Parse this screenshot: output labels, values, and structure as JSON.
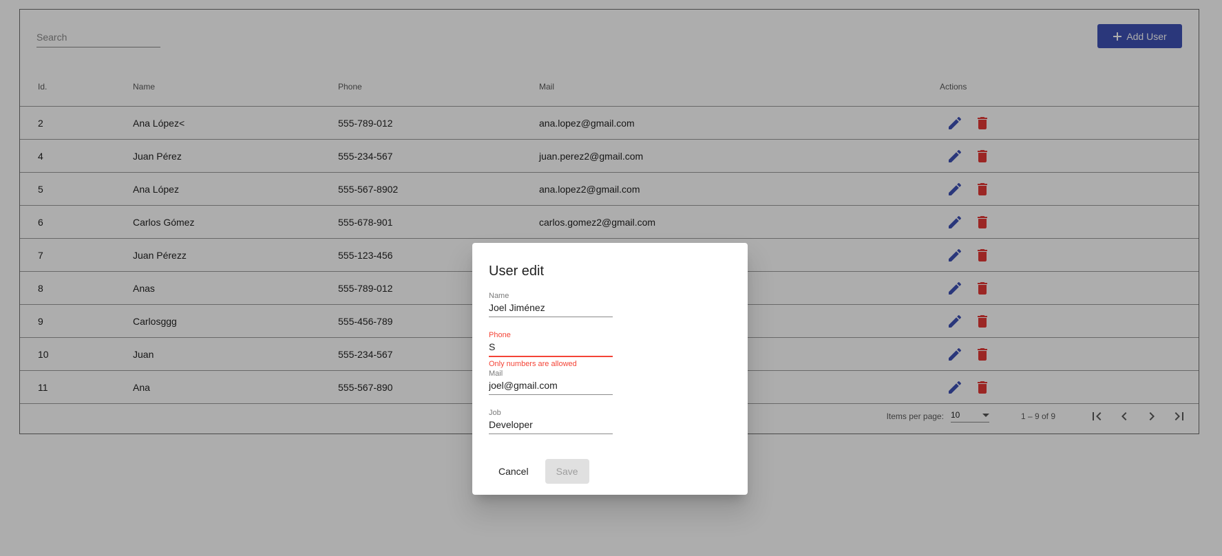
{
  "toolbar": {
    "search_placeholder": "Search",
    "add_user_label": "Add User"
  },
  "table": {
    "headers": {
      "id": "Id.",
      "name": "Name",
      "phone": "Phone",
      "mail": "Mail",
      "actions": "Actions"
    },
    "rows": [
      {
        "id": "2",
        "name": "Ana López<",
        "phone": "555-789-012",
        "mail": "ana.lopez@gmail.com"
      },
      {
        "id": "4",
        "name": "Juan Pérez",
        "phone": "555-234-567",
        "mail": "juan.perez2@gmail.com"
      },
      {
        "id": "5",
        "name": "Ana López",
        "phone": "555-567-8902",
        "mail": "ana.lopez2@gmail.com"
      },
      {
        "id": "6",
        "name": "Carlos Gómez",
        "phone": "555-678-901",
        "mail": "carlos.gomez2@gmail.com"
      },
      {
        "id": "7",
        "name": "Juan Pérezz",
        "phone": "555-123-456",
        "mail": ""
      },
      {
        "id": "8",
        "name": "Anas",
        "phone": "555-789-012",
        "mail": ""
      },
      {
        "id": "9",
        "name": "Carlosggg",
        "phone": "555-456-789",
        "mail": ""
      },
      {
        "id": "10",
        "name": "Juan",
        "phone": "555-234-567",
        "mail": ""
      },
      {
        "id": "11",
        "name": "Ana",
        "phone": "555-567-890",
        "mail": ""
      }
    ]
  },
  "paginator": {
    "items_per_page_label": "Items per page:",
    "items_per_page_value": "10",
    "range_label": "1 – 9 of 9"
  },
  "dialog": {
    "title": "User edit",
    "fields": {
      "name": {
        "label": "Name",
        "value": "Joel Jiménez"
      },
      "phone": {
        "label": "Phone",
        "value": "S",
        "error": "Only numbers are allowed"
      },
      "mail": {
        "label": "Mail",
        "value": "joel@gmail.com"
      },
      "job": {
        "label": "Job",
        "value": "Developer"
      }
    },
    "cancel_label": "Cancel",
    "save_label": "Save"
  },
  "colors": {
    "primary": "#3f51b5",
    "edit_icon": "#3f51b5",
    "delete_icon": "#e53935",
    "error": "#f44336",
    "backdrop": "rgba(0,0,0,0.32)"
  },
  "icons": {
    "add": "plus-icon",
    "edit": "pencil-icon",
    "delete": "trash-icon",
    "first": "first-page-icon",
    "prev": "chevron-left-icon",
    "next": "chevron-right-icon",
    "last": "last-page-icon"
  }
}
